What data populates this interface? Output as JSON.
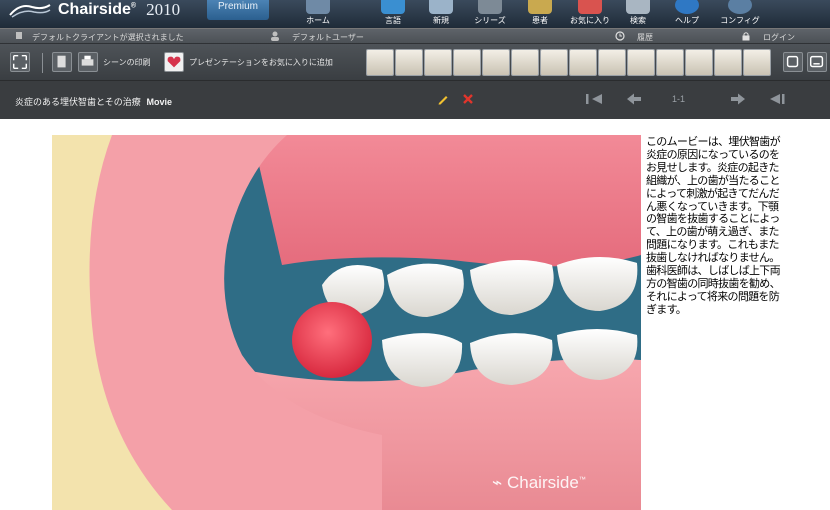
{
  "app": {
    "brand": "Chairside",
    "year": "2010",
    "edition": "Premium"
  },
  "nav": [
    {
      "label": "ホーム",
      "icon": "home-icon"
    },
    {
      "label": "言語",
      "icon": "language-icon"
    },
    {
      "label": "新規",
      "icon": "new-icon"
    },
    {
      "label": "シリーズ",
      "icon": "series-icon"
    },
    {
      "label": "患者",
      "icon": "patient-icon"
    },
    {
      "label": "お気に入り",
      "icon": "favorites-icon"
    },
    {
      "label": "検索",
      "icon": "search-icon"
    },
    {
      "label": "ヘルプ",
      "icon": "help-icon"
    },
    {
      "label": "コンフィグ",
      "icon": "config-icon"
    }
  ],
  "status": {
    "client": "デフォルトクライアントが選択されました",
    "user": "デフォルトユーザー",
    "history": "履歴",
    "login": "ログイン"
  },
  "toolbar": {
    "print_label": "シーンの印刷",
    "favorite_label": "プレゼンテーションをお気に入りに追加"
  },
  "title_bar": {
    "title": "炎症のある埋伏智歯とその治療",
    "type": "Movie",
    "pager": "1-1"
  },
  "video": {
    "watermark": "Chairside"
  },
  "description": "このムービーは、埋伏智歯が炎症の原因になっているのをお見せします。炎症の起きた組織が、上の歯が当たることによって刺激が起きてだんだん悪くなっていきます。下顎の智歯を抜歯することによって、上の歯が萌え過ぎ、また問題になります。これもまた抜歯しなければなりません。歯科医師は、しばしば上下両方の智歯の同時抜歯を勧め、それによって将来の問題を防ぎます。"
}
